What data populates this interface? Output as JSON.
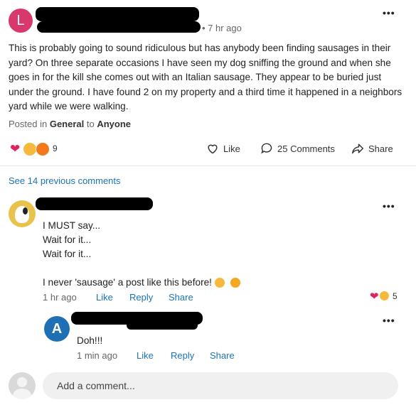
{
  "post": {
    "author_initial": "L",
    "time": "7 hr ago",
    "body": "This is probably going to sound ridiculous but has anybody been finding sausages in their yard?  On three separate occasions I have seen my dog sniffing the ground and when she goes in for the kill she comes out with an Italian sausage.  They appear to be buried just under the ground.  I have found 2 on my property and a third time it happened in a neighbors yard while we were walking.",
    "posted_in_prefix": "Posted in",
    "group": "General",
    "to_word": "to",
    "audience": "Anyone",
    "reaction_count": "9",
    "like_label": "Like",
    "comments_label": "25 Comments",
    "share_label": "Share"
  },
  "previous_comments_label": "See 14 previous comments",
  "comment1": {
    "lines": [
      "I MUST say...",
      "Wait for it...",
      "Wait for it...",
      "",
      "I never 'sausage' a post like this before!"
    ],
    "time": "1 hr ago",
    "like_label": "Like",
    "reply_label": "Reply",
    "share_label": "Share",
    "reaction_count": "5"
  },
  "comment2": {
    "author_initial": "A",
    "text": "Doh!!!",
    "time": "1 min ago",
    "like_label": "Like",
    "reply_label": "Reply",
    "share_label": "Share"
  },
  "add_comment_placeholder": "Add a comment...",
  "colors": {
    "link": "#1a73b8",
    "avatar_l": "#d9386c",
    "avatar_a": "#1f6fb5"
  }
}
